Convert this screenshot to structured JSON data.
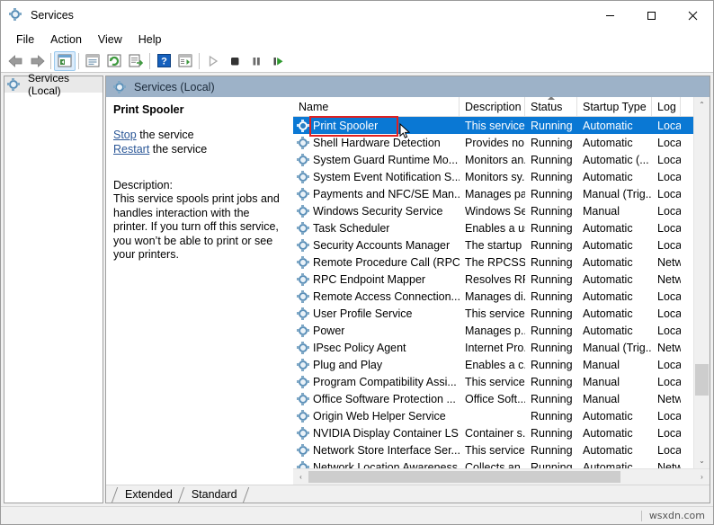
{
  "window": {
    "title": "Services",
    "icon": "services-gear-icon",
    "controls": {
      "minimize": "—",
      "maximize": "☐",
      "close": "✕"
    }
  },
  "menu": {
    "items": [
      "File",
      "Action",
      "View",
      "Help"
    ]
  },
  "toolbar": {
    "buttons": [
      {
        "name": "back-button",
        "glyph": "←",
        "enabled": true
      },
      {
        "name": "forward-button",
        "glyph": "→",
        "enabled": true
      },
      {
        "name": "show-hide-console-tree-button",
        "glyph": "▤",
        "selected": true
      },
      {
        "name": "properties-button",
        "glyph": "▥",
        "enabled": true
      },
      {
        "name": "refresh-button",
        "glyph": "↻",
        "enabled": true
      },
      {
        "name": "export-list-button",
        "glyph": "⎘",
        "enabled": true
      },
      {
        "name": "help-button",
        "glyph": "?",
        "enabled": true
      },
      {
        "name": "show-action-pane-button",
        "glyph": "▦",
        "enabled": true
      },
      {
        "name": "start-service-button",
        "glyph": "▶",
        "enabled": false
      },
      {
        "name": "stop-service-button",
        "glyph": "■",
        "enabled": true
      },
      {
        "name": "pause-service-button",
        "glyph": "▐▌",
        "enabled": true
      },
      {
        "name": "restart-service-button",
        "glyph": "⏵",
        "enabled": true
      }
    ]
  },
  "tree": {
    "root_label": "Services (Local)",
    "root_icon": "services-gear-icon"
  },
  "pane_header": {
    "label": "Services (Local)",
    "icon": "services-gear-icon"
  },
  "detail": {
    "service_name": "Print Spooler",
    "stop_link": "Stop",
    "stop_suffix": " the service",
    "restart_link": "Restart",
    "restart_suffix": " the service",
    "description_label": "Description:",
    "description_text": "This service spools print jobs and handles interaction with the printer. If you turn off this service, you won’t be able to print or see your printers."
  },
  "list": {
    "columns": [
      {
        "key": "name",
        "label": "Name",
        "width": 185,
        "sorted": false
      },
      {
        "key": "description",
        "label": "Description",
        "width": 73,
        "sorted": false
      },
      {
        "key": "status",
        "label": "Status",
        "width": 58,
        "sorted": true,
        "sort_dir": "asc"
      },
      {
        "key": "startup",
        "label": "Startup Type",
        "width": 83,
        "sorted": false
      },
      {
        "key": "logon",
        "label": "Log",
        "width": 32,
        "sorted": false
      }
    ],
    "selected_index": 0,
    "rows": [
      {
        "name": "Print Spooler",
        "description": "This service ...",
        "status": "Running",
        "startup": "Automatic",
        "logon": "Loca"
      },
      {
        "name": "Shell Hardware Detection",
        "description": "Provides no...",
        "status": "Running",
        "startup": "Automatic",
        "logon": "Loca"
      },
      {
        "name": "System Guard Runtime Mo...",
        "description": "Monitors an...",
        "status": "Running",
        "startup": "Automatic (...",
        "logon": "Loca"
      },
      {
        "name": "System Event Notification S...",
        "description": "Monitors sy...",
        "status": "Running",
        "startup": "Automatic",
        "logon": "Loca"
      },
      {
        "name": "Payments and NFC/SE Man...",
        "description": "Manages pa...",
        "status": "Running",
        "startup": "Manual (Trig...",
        "logon": "Loca"
      },
      {
        "name": "Windows Security Service",
        "description": "Windows Se...",
        "status": "Running",
        "startup": "Manual",
        "logon": "Loca"
      },
      {
        "name": "Task Scheduler",
        "description": "Enables a us...",
        "status": "Running",
        "startup": "Automatic",
        "logon": "Loca"
      },
      {
        "name": "Security Accounts Manager",
        "description": "The startup ...",
        "status": "Running",
        "startup": "Automatic",
        "logon": "Loca"
      },
      {
        "name": "Remote Procedure Call (RPC)",
        "description": "The RPCSS s...",
        "status": "Running",
        "startup": "Automatic",
        "logon": "Netw"
      },
      {
        "name": "RPC Endpoint Mapper",
        "description": "Resolves RP...",
        "status": "Running",
        "startup": "Automatic",
        "logon": "Netw"
      },
      {
        "name": "Remote Access Connection...",
        "description": "Manages di...",
        "status": "Running",
        "startup": "Automatic",
        "logon": "Loca"
      },
      {
        "name": "User Profile Service",
        "description": "This service ...",
        "status": "Running",
        "startup": "Automatic",
        "logon": "Loca"
      },
      {
        "name": "Power",
        "description": "Manages p...",
        "status": "Running",
        "startup": "Automatic",
        "logon": "Loca"
      },
      {
        "name": "IPsec Policy Agent",
        "description": "Internet Pro...",
        "status": "Running",
        "startup": "Manual (Trig...",
        "logon": "Netw"
      },
      {
        "name": "Plug and Play",
        "description": "Enables a c...",
        "status": "Running",
        "startup": "Manual",
        "logon": "Loca"
      },
      {
        "name": "Program Compatibility Assi...",
        "description": "This service ...",
        "status": "Running",
        "startup": "Manual",
        "logon": "Loca"
      },
      {
        "name": "Office Software Protection ...",
        "description": "Office Soft...",
        "status": "Running",
        "startup": "Manual",
        "logon": "Netw"
      },
      {
        "name": "Origin Web Helper Service",
        "description": "",
        "status": "Running",
        "startup": "Automatic",
        "logon": "Loca"
      },
      {
        "name": "NVIDIA Display Container LS",
        "description": "Container s...",
        "status": "Running",
        "startup": "Automatic",
        "logon": "Loca"
      },
      {
        "name": "Network Store Interface Ser...",
        "description": "This service ...",
        "status": "Running",
        "startup": "Automatic",
        "logon": "Loca"
      },
      {
        "name": "Network Location Awareness",
        "description": "Collects an...",
        "status": "Running",
        "startup": "Automatic",
        "logon": "Netw"
      }
    ]
  },
  "scrollbars": {
    "vertical": {
      "up_glyph": "⌃",
      "down_glyph": "⌄",
      "thumb_top_pct": 74,
      "thumb_height_pct": 9
    },
    "horizontal": {
      "left_glyph": "‹",
      "right_glyph": "›",
      "thumb_left_pct": 0,
      "thumb_width_pct": 81
    }
  },
  "tabs": {
    "items": [
      "Extended",
      "Standard"
    ],
    "active": "Standard"
  },
  "statusbar": {
    "watermark": "wsxdn.com"
  },
  "annotation": {
    "color": "#e02020",
    "target": "Print Spooler"
  },
  "colors": {
    "selection_blue": "#0a78d4",
    "pane_header": "#9db2c8",
    "link_blue": "#2b5797",
    "annotation_red": "#e02020",
    "window_bg": "#f0f0f0"
  }
}
